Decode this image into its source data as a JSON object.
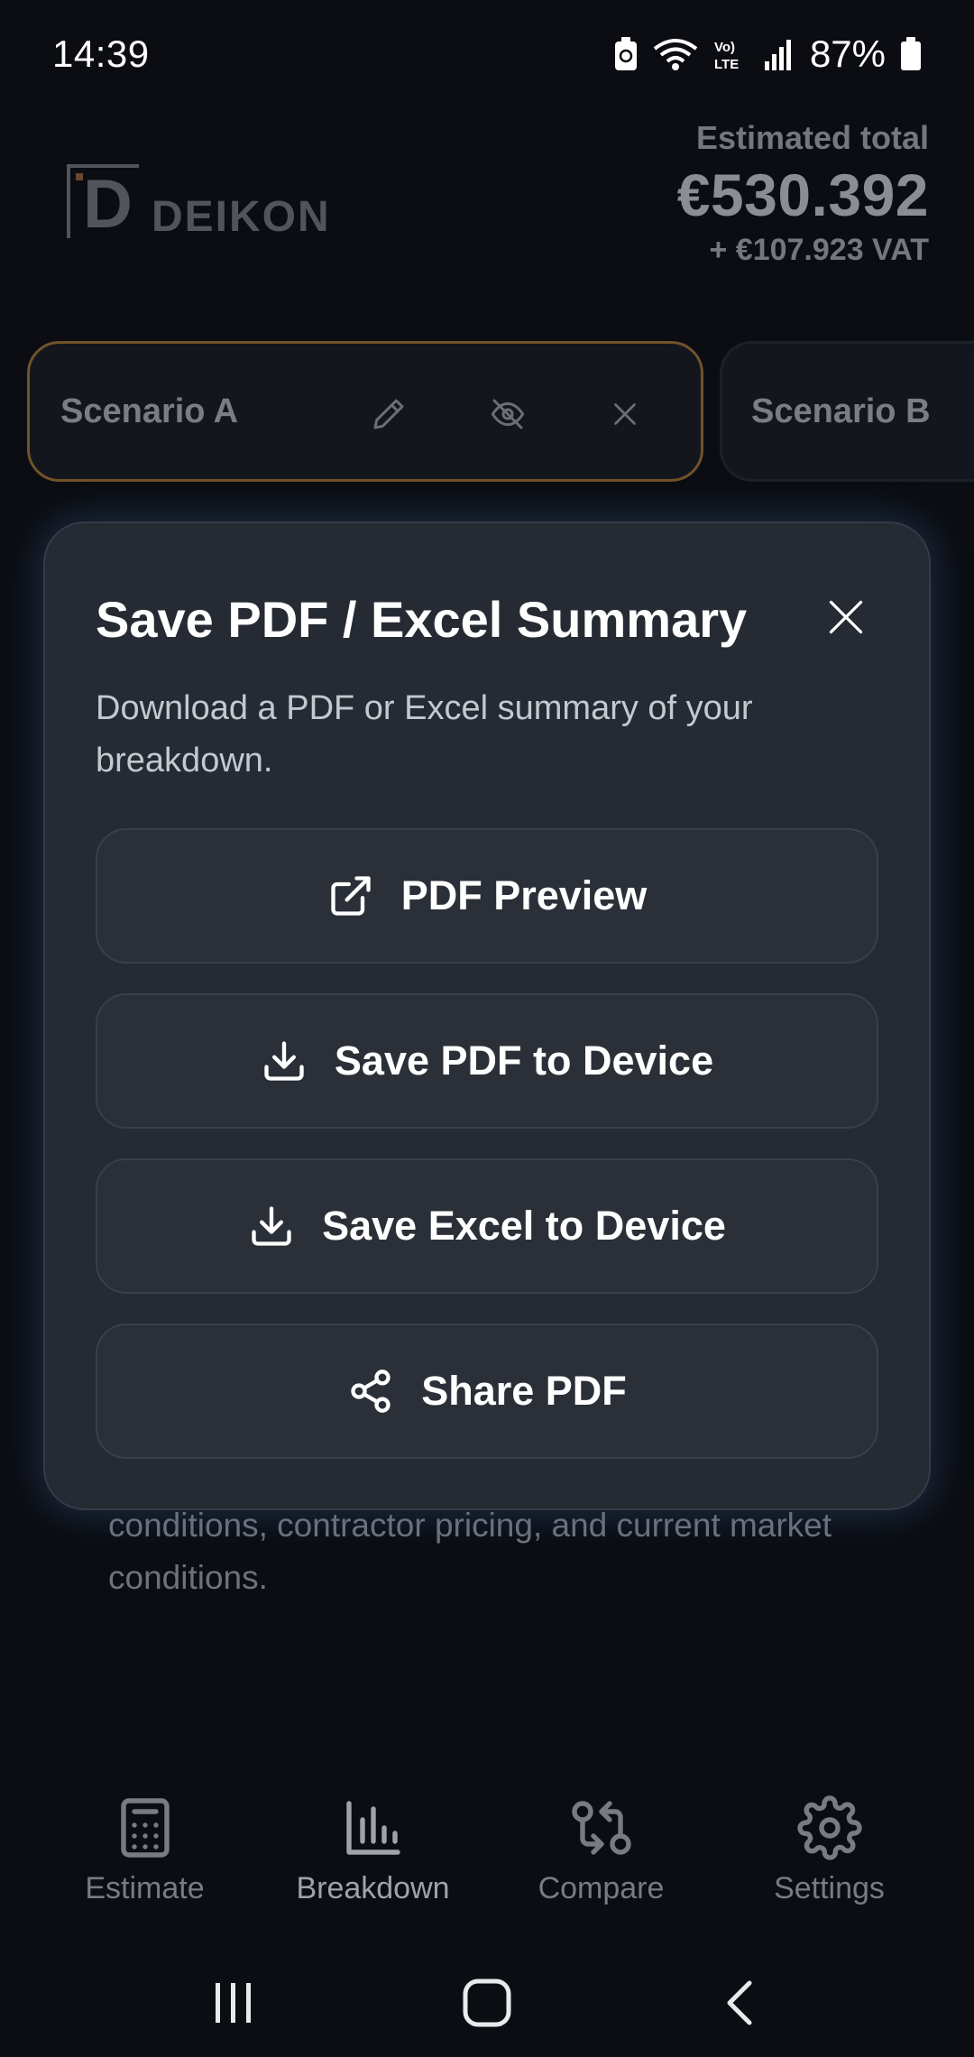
{
  "status_bar": {
    "time": "14:39",
    "battery": "87%"
  },
  "header": {
    "logo_text": "DEIKON",
    "total_label": "Estimated total",
    "total_value": "€530.392",
    "total_vat": "+ €107.923 VAT"
  },
  "scenarios": [
    {
      "name": "Scenario A"
    },
    {
      "name": "Scenario B"
    }
  ],
  "background_text": "conditions, contractor pricing, and current market conditions.",
  "modal": {
    "title": "Save PDF / Excel Summary",
    "description": "Download a PDF or Excel summary of your breakdown.",
    "buttons": [
      {
        "label": "PDF Preview",
        "icon": "external-link-icon"
      },
      {
        "label": "Save PDF to Device",
        "icon": "download-icon"
      },
      {
        "label": "Save Excel to Device",
        "icon": "download-icon"
      },
      {
        "label": "Share PDF",
        "icon": "share-icon"
      }
    ]
  },
  "bottom_nav": [
    {
      "label": "Estimate",
      "icon": "calculator-icon"
    },
    {
      "label": "Breakdown",
      "icon": "bar-chart-icon"
    },
    {
      "label": "Compare",
      "icon": "compare-icon"
    },
    {
      "label": "Settings",
      "icon": "gear-icon"
    }
  ],
  "colors": {
    "background": "#0b0d12",
    "modal": "#262a33",
    "accent_border": "#c78c3c"
  }
}
